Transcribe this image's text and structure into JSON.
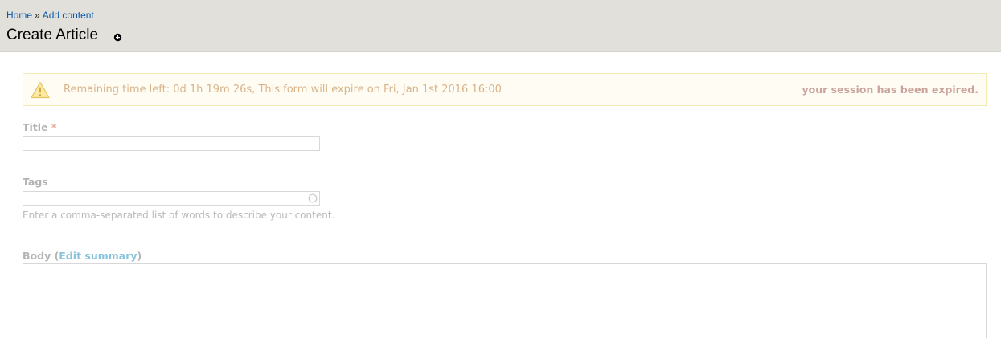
{
  "breadcrumb": {
    "home": "Home",
    "separator": "»",
    "add_content": "Add content"
  },
  "header": {
    "title": "Create Article",
    "shortcut_icon": "plus-circle-icon"
  },
  "warning": {
    "icon": "warning-triangle-icon",
    "message": "Remaining time left: 0d 1h 19m 26s, This form will expire on Fri, Jan 1st 2016 16:00",
    "status": "your session has been expired."
  },
  "form": {
    "title": {
      "label": "Title",
      "required_marker": "*",
      "value": ""
    },
    "tags": {
      "label": "Tags",
      "value": "",
      "autocomplete_icon": "autocomplete-throbber-icon",
      "description": "Enter a comma-separated list of words to describe your content."
    },
    "body": {
      "label": "Body",
      "open_paren": "(",
      "edit_summary_link": "Edit summary",
      "close_paren": ")",
      "value": ""
    }
  },
  "colors": {
    "header_bg": "#e1e0db",
    "link": "#0b5aa8",
    "warning_bg": "#fffdf3",
    "warning_border": "#f4ecb5",
    "warning_text": "#d8b38a",
    "required": "#e9a997"
  }
}
